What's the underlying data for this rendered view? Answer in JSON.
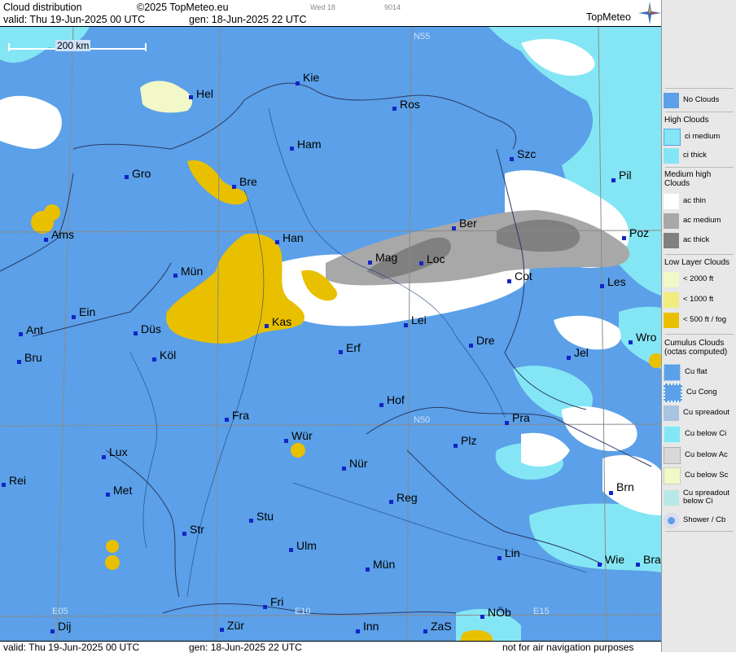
{
  "header": {
    "title": "Cloud distribution",
    "copyright": "©2025 TopMeteo.eu",
    "valid": "valid:  Thu  19-Jun-2025  00 UTC",
    "gen": "gen: 18-Jun-2025 22 UTC",
    "tiny1": "Wed 18",
    "tiny2": "9014",
    "logo": "TopMeteo"
  },
  "footer": {
    "valid": "valid:  Thu  19-Jun-2025  00 UTC",
    "gen": "gen: 18-Jun-2025 22 UTC",
    "note": "not for air navigation purposes"
  },
  "scale_label": "200 km",
  "grid_labels": {
    "n55": "N55",
    "n50": "N50",
    "e05": "E05",
    "e10": "E10",
    "e15": "E15"
  },
  "cities": [
    {
      "name": "Hel"
    },
    {
      "name": "Kie"
    },
    {
      "name": "Ros"
    },
    {
      "name": "Ham"
    },
    {
      "name": "Szc"
    },
    {
      "name": "Gro"
    },
    {
      "name": "Bre"
    },
    {
      "name": "Pil"
    },
    {
      "name": "Ber"
    },
    {
      "name": "Ams"
    },
    {
      "name": "Han"
    },
    {
      "name": "Poz"
    },
    {
      "name": "Mag"
    },
    {
      "name": "Loc"
    },
    {
      "name": "Mün"
    },
    {
      "name": "Cot"
    },
    {
      "name": "Les"
    },
    {
      "name": "Ein"
    },
    {
      "name": "Kas"
    },
    {
      "name": "Lei"
    },
    {
      "name": "Ant"
    },
    {
      "name": "Düs"
    },
    {
      "name": "Wro"
    },
    {
      "name": "Dre"
    },
    {
      "name": "Bru"
    },
    {
      "name": "Köl"
    },
    {
      "name": "Erf"
    },
    {
      "name": "Jel"
    },
    {
      "name": "Hof"
    },
    {
      "name": "Fra"
    },
    {
      "name": "Pra"
    },
    {
      "name": "Wür"
    },
    {
      "name": "Plz"
    },
    {
      "name": "Lux"
    },
    {
      "name": "Nür"
    },
    {
      "name": "Rei"
    },
    {
      "name": "Met"
    },
    {
      "name": "Reg"
    },
    {
      "name": "Brn"
    },
    {
      "name": "Stu"
    },
    {
      "name": "Str"
    },
    {
      "name": "Ulm"
    },
    {
      "name": "Lin"
    },
    {
      "name": "Mün"
    },
    {
      "name": "Wie"
    },
    {
      "name": "Bra"
    },
    {
      "name": "Fri"
    },
    {
      "name": "Dij"
    },
    {
      "name": "Zür"
    },
    {
      "name": "NÖb"
    },
    {
      "name": "Inn"
    },
    {
      "name": "ZaS"
    }
  ],
  "legend": {
    "no_clouds": "No Clouds",
    "high_title": "High Clouds",
    "ci_medium": "ci medium",
    "ci_thick": "ci thick",
    "medium_title": "Medium high Clouds",
    "ac_thin": "ac thin",
    "ac_medium": "ac medium",
    "ac_thick": "ac thick",
    "low_title": "Low Layer Clouds",
    "low_2000": "< 2000 ft",
    "low_1000": "< 1000 ft",
    "low_500": "< 500 ft / fog",
    "cu_title": "Cumulus Clouds (octas computed)",
    "cu_flat": "Cu flat",
    "cu_cong": "Cu Cong",
    "cu_spread": "Cu spreadout",
    "cu_below_ci": "Cu below Ci",
    "cu_below_ac": "Cu below Ac",
    "cu_below_sc": "Cu below Sc",
    "cu_spread_ci": "Cu spreadout below Ci",
    "shower": "Shower / Cb"
  },
  "colors": {
    "no_clouds": "#5ba0e8",
    "ci_thick": "#84e6f4",
    "ac_thin": "#ffffff",
    "ac_medium": "#a8a8a8",
    "ac_thick": "#808080",
    "low_500": "#e8c000",
    "low_2000": "#f2f8c8",
    "city_marker": "#1226c8"
  }
}
